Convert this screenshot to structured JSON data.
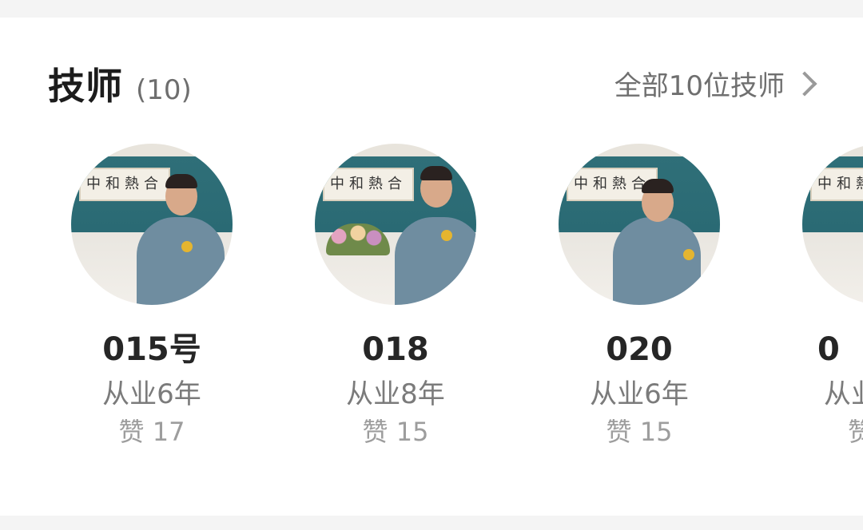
{
  "section": {
    "title": "技师",
    "count": "(10)",
    "view_all_label": "全部10位技师"
  },
  "technicians": [
    {
      "name": "015号",
      "experience": "从业6年",
      "likes": "赞 17"
    },
    {
      "name": "018",
      "experience": "从业8年",
      "likes": "赞 15"
    },
    {
      "name": "020",
      "experience": "从业6年",
      "likes": "赞 15"
    },
    {
      "name": "0",
      "experience": "从业",
      "likes": "赞"
    }
  ],
  "banner_text": "中和熱合"
}
